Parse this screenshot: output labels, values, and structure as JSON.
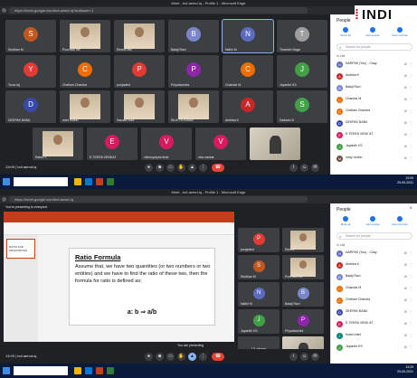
{
  "logo": {
    "text": "INDI"
  },
  "top": {
    "window_title": "Meet - bcf-aemd-iq - Profile 1 - Microsoft Edge",
    "url": "https://meet.google.com/bcf-aemd-iq?authuser=1",
    "tiles": [
      {
        "letter": "S",
        "name": "Sindhan M",
        "color": "#c2561f"
      },
      {
        "letter": "",
        "name": "Poorvika Vel",
        "color": "#5f6368",
        "photo": true
      },
      {
        "letter": "",
        "name": "Reena ravi",
        "color": "#5f6368",
        "photo": true
      },
      {
        "letter": "B",
        "name": "Balaji Ravi",
        "color": "#7986cb"
      },
      {
        "letter": "N",
        "name": "Nalini M",
        "color": "#5c6bc0",
        "active": true
      },
      {
        "letter": "T",
        "name": "Thamizh Naga",
        "color": "#9e9e9e"
      },
      {
        "letter": "Y",
        "name": "Yuva raj",
        "color": "#e53935"
      },
      {
        "letter": "C",
        "name": "Chellam Chandra",
        "color": "#ef6c00"
      },
      {
        "letter": "P",
        "name": "poojadevi",
        "color": "#e53935"
      },
      {
        "letter": "P",
        "name": "Priyadarshini",
        "color": "#8e24aa"
      },
      {
        "letter": "C",
        "name": "Chandar M",
        "color": "#ef6c00"
      },
      {
        "letter": "J",
        "name": "Jayanthi KS",
        "color": "#43a047"
      },
      {
        "letter": "D",
        "name": "DEEPAK BABU",
        "color": "#3949ab"
      },
      {
        "letter": "",
        "name": "mari muthu",
        "color": "#5f6368",
        "photo": true
      },
      {
        "letter": "",
        "name": "Sanathi sum",
        "color": "#5f6368",
        "photo": true
      },
      {
        "letter": "",
        "name": "SILIK ROOBAN",
        "color": "#5f6368",
        "photo": true
      },
      {
        "letter": "A",
        "name": "Ambika K",
        "color": "#c62828"
      },
      {
        "letter": "S",
        "name": "Sadashi D",
        "color": "#43a047"
      },
      {
        "letter": "",
        "name": "Rahul V",
        "color": "#5f6368",
        "photo": true
      },
      {
        "letter": "E",
        "name": "E.TEERA VENKAT",
        "color": "#d81b60"
      },
      {
        "letter": "V",
        "name": "vishnupriyah khat",
        "color": "#d81b60"
      },
      {
        "letter": "V",
        "name": "viva sankar",
        "color": "#d81b60"
      },
      {
        "letter": "",
        "name": "",
        "color": "#5f6368",
        "webcam": true
      }
    ],
    "clock": "13:09 | bcf-aemd-iq",
    "panel": {
      "title": "People",
      "close": "×",
      "actions": [
        "Show all",
        "Add people",
        "Host controls"
      ],
      "search_placeholder": "Search for people",
      "section": "In call",
      "people": [
        {
          "letter": "N",
          "name": "NARPAS (You) - Chay",
          "color": "#5c6bc0"
        },
        {
          "letter": "A",
          "name": "Ambika K",
          "color": "#c62828"
        },
        {
          "letter": "B",
          "name": "Balaji Ravi",
          "color": "#7986cb"
        },
        {
          "letter": "C",
          "name": "Chandar M",
          "color": "#ef6c00"
        },
        {
          "letter": "C",
          "name": "Chellam Chandra",
          "color": "#ef6c00"
        },
        {
          "letter": "D",
          "name": "DEEPAK BABU",
          "color": "#3949ab"
        },
        {
          "letter": "E",
          "name": "E.TEERA VENK AT",
          "color": "#d81b60"
        },
        {
          "letter": "J",
          "name": "Jayanthi KS",
          "color": "#43a047"
        },
        {
          "letter": "M",
          "name": "mary muthu",
          "color": "#6d4c41"
        }
      ]
    },
    "taskbar_time": "13:09\n29-09-2021"
  },
  "bottom": {
    "window_title": "Meet - bcf-aemd-iq - Profile 1 - Microsoft Edge",
    "url": "https://meet.google.com/bcf-aemd-iq",
    "banner": "You're presenting to everyone",
    "slide": {
      "thumb_label": "RATIO AND PROPORTION",
      "heading": "Ratio Formula",
      "body": "Assume that, we have two quantities (or two numbers or two entities) and we have to find the ratio of these two, then the formula for ratio is defined as;",
      "formula": "a: b ⇒ a/b"
    },
    "tiles": [
      {
        "letter": "P",
        "name": "poojadevi",
        "color": "#e53935"
      },
      {
        "letter": "",
        "name": "Reena",
        "color": "#5f6368",
        "photo": true
      },
      {
        "letter": "S",
        "name": "Sindhan M",
        "color": "#c2561f"
      },
      {
        "letter": "",
        "name": "Poorvika Vel",
        "color": "#5f6368",
        "photo": true
      },
      {
        "letter": "N",
        "name": "Nalini M",
        "color": "#5c6bc0"
      },
      {
        "letter": "B",
        "name": "Balaji Ravi",
        "color": "#7986cb"
      },
      {
        "letter": "J",
        "name": "Jayanthi KS",
        "color": "#43a047"
      },
      {
        "letter": "P",
        "name": "Priyadarshini",
        "color": "#8e24aa"
      },
      {
        "letter": "",
        "name": "13 others",
        "color": "#5f6368",
        "others": true
      },
      {
        "letter": "",
        "name": "",
        "color": "#5f6368",
        "webcam": true
      }
    ],
    "clock": "13:29 | bcf-aemd-iq",
    "presenting_label": "You are presenting",
    "panel": {
      "title": "People",
      "close": "×",
      "actions": [
        "Mute all",
        "Add people",
        "Host controls"
      ],
      "search_placeholder": "Search for people",
      "section": "In call",
      "people": [
        {
          "letter": "N",
          "name": "NARPAS (You) - Chay",
          "color": "#5c6bc0"
        },
        {
          "letter": "A",
          "name": "Ambika K",
          "color": "#c62828"
        },
        {
          "letter": "B",
          "name": "Balaji Ravi",
          "color": "#7986cb"
        },
        {
          "letter": "C",
          "name": "Chandar M",
          "color": "#ef6c00"
        },
        {
          "letter": "C",
          "name": "Chellam Chandra",
          "color": "#ef6c00"
        },
        {
          "letter": "D",
          "name": "DEEPAK BABU",
          "color": "#3949ab"
        },
        {
          "letter": "E",
          "name": "E.TEERA VENK AT",
          "color": "#d81b60"
        },
        {
          "letter": "I",
          "name": "Ishan mani",
          "color": "#00897b"
        },
        {
          "letter": "J",
          "name": "Jayanthi KS",
          "color": "#43a047"
        }
      ]
    },
    "taskbar_time": "13:29\n29-09-2021"
  }
}
